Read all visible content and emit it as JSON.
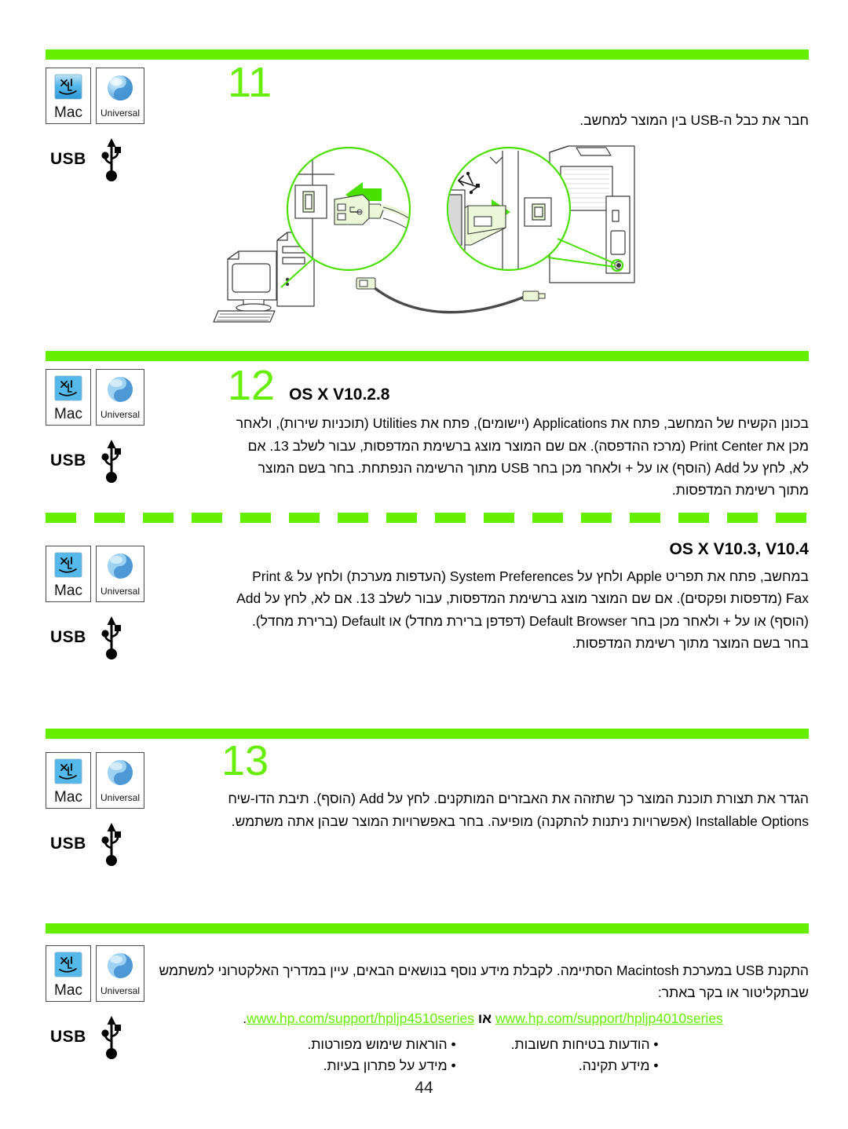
{
  "page": {
    "number": "44",
    "accent_color": "#66ee00"
  },
  "badges": {
    "mac_label": "Mac",
    "universal_label": "Universal",
    "usb_label": "USB",
    "mac_icon": "mac-finder-face-icon",
    "universal_icon": "universal-sphere-icon",
    "usb_icon": "usb-trident-icon"
  },
  "sections": [
    {
      "id": "step-11",
      "number": "11",
      "os_label": "",
      "paragraphs": [
        "חבר את כבל ה-USB בין המוצר למחשב."
      ],
      "illustration": "usb-cable-computer-to-printer-illustration"
    },
    {
      "id": "step-12-v1028",
      "number": "12",
      "os_label": "OS X V10.2.8",
      "paragraphs": [
        "בכונן הקשיח של המחשב, פתח את Applications (יישומים), פתח את Utilities (תוכניות שירות), ולאחר מכן את Print Center (מרכז ההדפסה). אם שם המוצר מוצג ברשימת המדפסות, עבור לשלב 13. אם לא, לחץ על Add (הוסף) או על + ולאחר מכן בחר USB מתוך הרשימה הנפתחת. בחר בשם המוצר מתוך רשימת המדפסות."
      ]
    },
    {
      "id": "step-12-v103-v104",
      "number": "",
      "os_label": "OS X V10.3, V10.4",
      "paragraphs": [
        "במחשב, פתח את תפריט Apple ולחץ על System Preferences (העדפות מערכת) ולחץ על Print & Fax (מדפסות ופקסים). אם שם המוצר מוצג ברשימת המדפסות, עבור לשלב 13. אם לא, לחץ על Add (הוסף) או על + ולאחר מכן בחר Default Browser (דפדפן ברירת מחדל) או Default (ברירת מחדל). בחר בשם המוצר מתוך רשימת המדפסות."
      ]
    },
    {
      "id": "step-13",
      "number": "13",
      "os_label": "",
      "paragraphs": [
        "הגדר את תצורת תוכנת המוצר כך שתזהה את האבזרים המותקנים. לחץ על Add (הוסף). תיבת הדו-שיח Installable Options (אפשרויות ניתנות להתקנה) מופיעה. בחר באפשרויות המוצר שבהן אתה משתמש."
      ]
    },
    {
      "id": "support-section",
      "number": "",
      "os_label": "",
      "paragraphs": [
        "התקנת USB במערכת Macintosh הסתיימה. לקבלת מידע נוסף בנושאים הבאים, עיין במדריך האלקטרוני למשתמש שבתקליטור או בקר באתר:"
      ]
    }
  ],
  "support": {
    "url_primary": "www.hp.com/support/hpljp4010series",
    "url_secondary": "www.hp.com/support/hpljp4510series",
    "or_word": "או",
    "trailing_period": ".",
    "bullets_right": [
      "הוראות שימוש מפורטות.",
      "מידע על פתרון בעיות."
    ],
    "bullets_left": [
      "הודעות בטיחות חשובות.",
      "מידע תקינה."
    ]
  }
}
